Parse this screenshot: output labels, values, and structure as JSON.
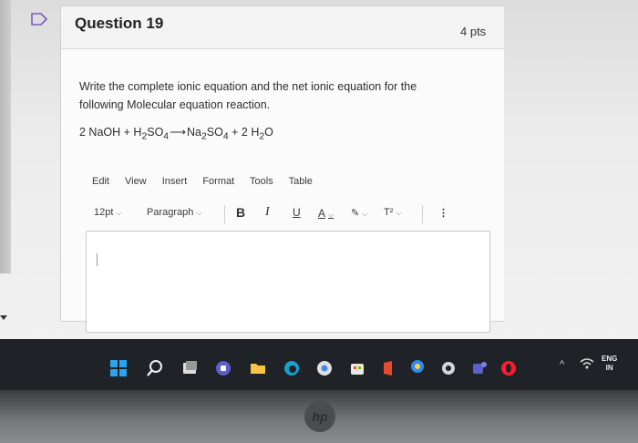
{
  "question": {
    "title": "Question 19",
    "points": "4 pts",
    "prompt": "Write the complete ionic equation and the net ionic equation for the following Molecular equation reaction.",
    "equation": {
      "term1": "2 NaOH + H",
      "sub1": "2",
      "term2": "SO",
      "sub2": "4",
      "arrow": "⟶",
      "term3": "Na",
      "sub3": "2",
      "term4": "SO",
      "sub4": "4",
      "term5": " + 2 H",
      "sub5": "2",
      "term6": "O"
    }
  },
  "editor": {
    "menu": [
      "Edit",
      "View",
      "Insert",
      "Format",
      "Tools",
      "Table"
    ],
    "toolbar": {
      "font_size": "12pt",
      "block_format": "Paragraph",
      "bold": "B",
      "italic": "I",
      "underline": "U",
      "text_color": "A",
      "superscript": "T²",
      "more": "⋮"
    },
    "content": ""
  },
  "taskbar": {
    "lang_line1": "ENG",
    "lang_line2": "IN",
    "icons": [
      "windows-start-icon",
      "search-icon",
      "task-view-icon",
      "teams-chat-icon",
      "file-explorer-icon",
      "edge-icon",
      "chrome-icon",
      "store-icon",
      "office-icon",
      "maps-pin-icon",
      "settings-icon",
      "teams-icon",
      "opera-icon"
    ]
  },
  "device": {
    "brand_mark": "hp"
  },
  "colors": {
    "flag": "#7a5cc4",
    "taskbar": "#1f2227",
    "editor_border": "#c9c9c9"
  }
}
